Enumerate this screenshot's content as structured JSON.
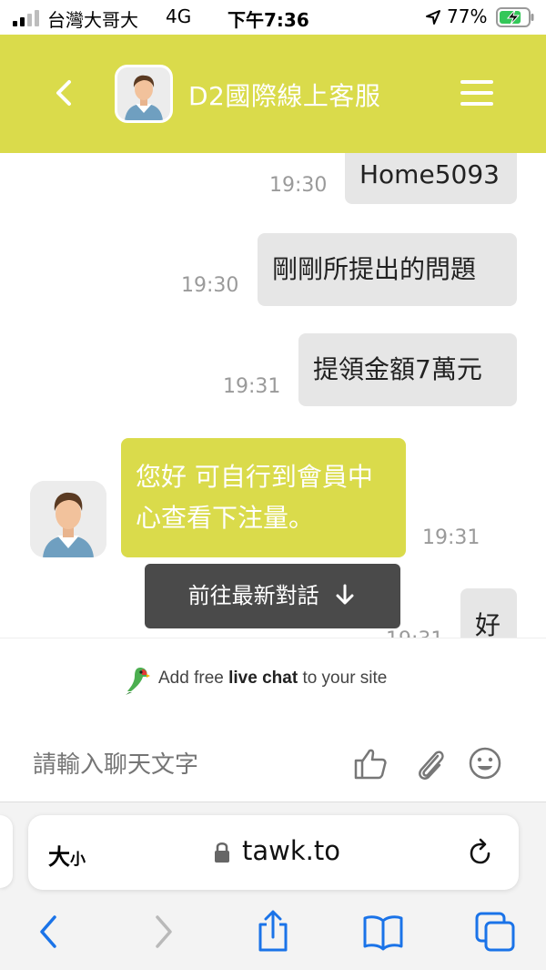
{
  "status_bar": {
    "carrier": "台灣大哥大",
    "network": "4G",
    "time": "下午7:36",
    "battery_percent": "77%",
    "battery_level": 0.77,
    "signal_bars": 2
  },
  "chat": {
    "header": {
      "title": "D2國際線上客服",
      "accent_color": "#dadb4b"
    },
    "messages": [
      {
        "direction": "outgoing",
        "text": "Home5093",
        "time": "19:30"
      },
      {
        "direction": "outgoing",
        "text": "剛剛所提出的問題",
        "time": "19:30"
      },
      {
        "direction": "outgoing",
        "text": "提領金額7萬元",
        "time": "19:31"
      },
      {
        "direction": "incoming",
        "text": "您好 可自行到會員中心查看下注量。",
        "time": "19:31"
      },
      {
        "direction": "outgoing",
        "text": "好",
        "time": "19:31"
      }
    ],
    "jump_button": {
      "label": "前往最新對話",
      "icon": "arrow-down-icon"
    },
    "branding": {
      "prefix": "Add free",
      "bold": "live chat",
      "suffix": "to your site"
    },
    "composer": {
      "placeholder": "請輸入聊天文字",
      "icons": [
        "thumbs-up-icon",
        "paperclip-icon",
        "smiley-icon"
      ]
    }
  },
  "browser": {
    "text_size_label": "大",
    "text_size_small": "小",
    "url": "tawk.to",
    "toolbar_icons": [
      "back-icon",
      "forward-icon",
      "share-icon",
      "bookmarks-icon",
      "tabs-icon"
    ],
    "accent_color": "#1a73e8"
  }
}
